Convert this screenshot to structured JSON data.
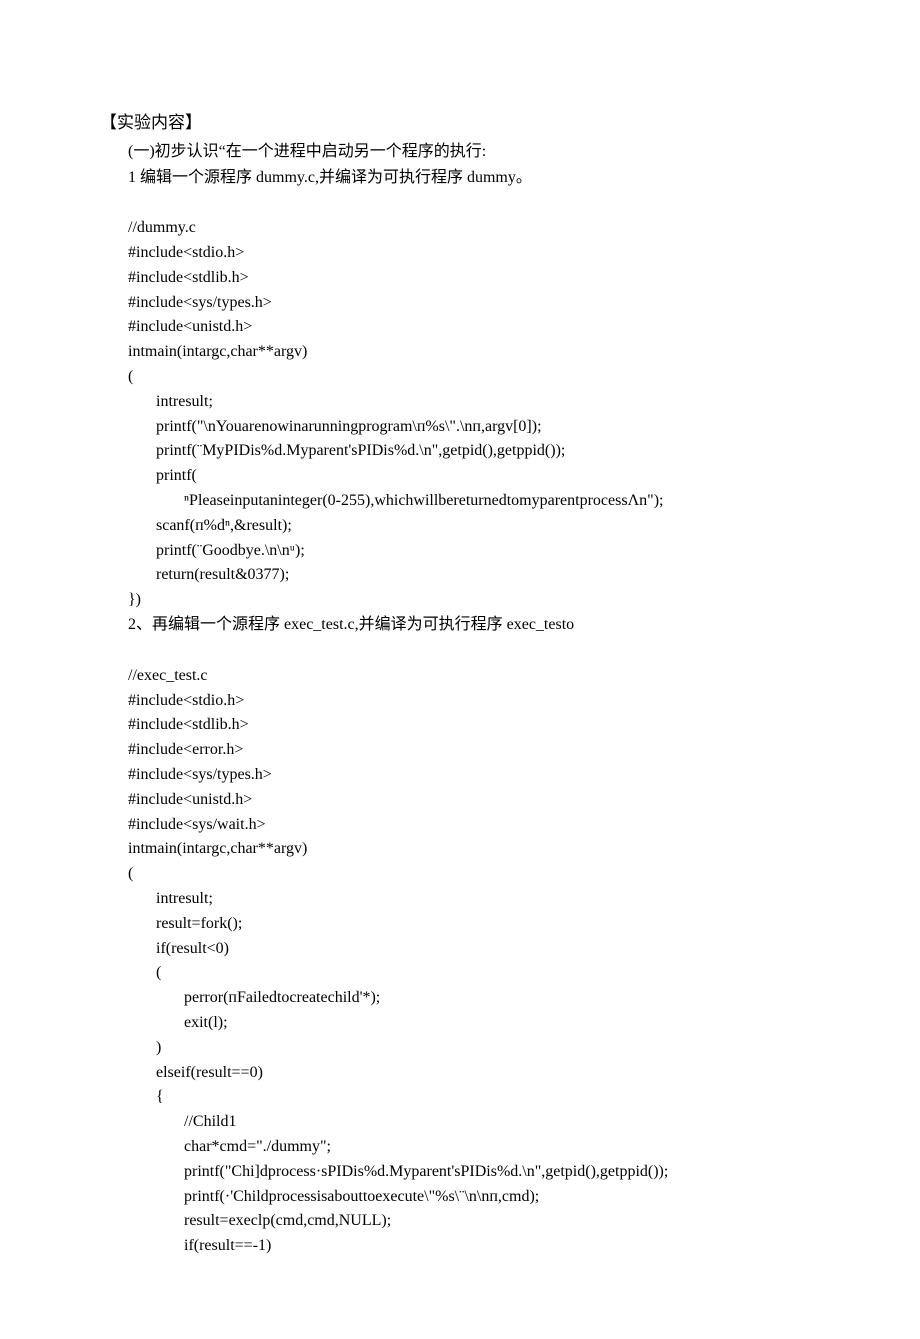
{
  "heading": "【实验内容】",
  "sec1_title": "(一)初步认识“在一个进程中启动另一个程序的执行:",
  "step1": "1 编辑一个源程序 dummy.c,并编译为可执行程序 dummy。",
  "c1_01": "//dummy.c",
  "c1_02": "#include<stdio.h>",
  "c1_03": "#include<stdlib.h>",
  "c1_04": "#include<sys/types.h>",
  "c1_05": "#include<unistd.h>",
  "c1_06": "intmain(intargc,char**argv)",
  "c1_07": "(",
  "c1_08": "intresult;",
  "c1_09": "printf(\"\\nYouarenowinarunningprogram\\ᴨ%s\\\".\\nᴨ,argv[0]);",
  "c1_10": "printf(¨MyPIDis%d.Myparent'sPIDis%d.\\n\",getpid(),getppid());",
  "c1_11": "printf(",
  "c1_12": "ⁿPleaseinputaninteger(0-255),whichwillbereturnedtomyparentprocessΛn\");",
  "c1_13": "scanf(ᴨ%dⁿ,&result);",
  "c1_14": "printf(¨Goodbye.\\n\\nᵘ);",
  "c1_15": "return(result&0377);",
  "c1_16": "})",
  "step2": "2、再编辑一个源程序 exec_test.c,并编译为可执行程序 exec_testo",
  "c2_01": "//exec_test.c",
  "c2_02": "#include<stdio.h>",
  "c2_03": "#include<stdlib.h>",
  "c2_04": "#include<error.h>",
  "c2_05": "#include<sys/types.h>",
  "c2_06": "#include<unistd.h>",
  "c2_07": "#include<sys/wait.h>",
  "c2_08": "intmain(intargc,char**argv)",
  "c2_09": "(",
  "c2_10": "intresult;",
  "c2_11": "result=fork();",
  "c2_12": "if(result<0)",
  "c2_13": "(",
  "c2_14": "perror(ᴨFailedtocreatechild'*);",
  "c2_15": "exit(l);",
  "c2_16": ")",
  "c2_17": "elseif(result==0)",
  "c2_18": "{",
  "c2_19": "//Child1",
  "c2_20": "char*cmd=\"./dummy\";",
  "c2_21": "printf(\"Chi]dprocess·sPIDis%d.Myparent'sPIDis%d.\\n\",getpid(),getppid());",
  "c2_22": "printf(·'Childprocessisabouttoexecute\\\"%s\\¨\\n\\nᴨ,cmd);",
  "c2_23": "result=execlp(cmd,cmd,NULL);",
  "c2_24": "if(result==-1)"
}
